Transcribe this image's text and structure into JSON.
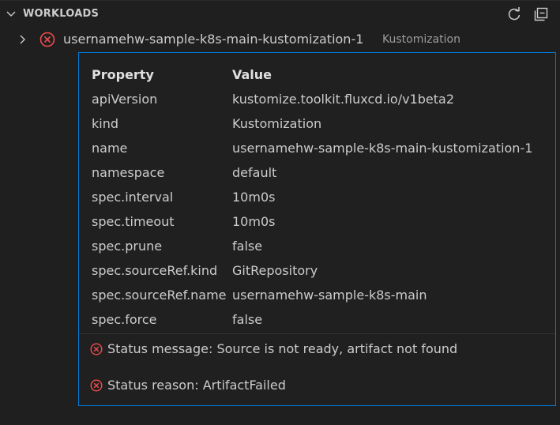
{
  "section": {
    "title": "WORKLOADS"
  },
  "toolbar": {
    "refresh_icon": "refresh-icon",
    "collapse_icon": "collapse-all-icon"
  },
  "colors": {
    "error": "#f14c4c",
    "accent_border": "#0078d4",
    "background": "#1f1f1f"
  },
  "tree": {
    "item": {
      "label": "usernamehw-sample-k8s-main-kustomization-1",
      "description": "Kustomization",
      "status_icon": "error-icon"
    }
  },
  "hover": {
    "headers": {
      "property": "Property",
      "value": "Value"
    },
    "rows": [
      {
        "property": "apiVersion",
        "value": "kustomize.toolkit.fluxcd.io/v1beta2"
      },
      {
        "property": "kind",
        "value": "Kustomization"
      },
      {
        "property": "name",
        "value": "usernamehw-sample-k8s-main-kustomization-1"
      },
      {
        "property": "namespace",
        "value": "default"
      },
      {
        "property": "spec.interval",
        "value": "10m0s"
      },
      {
        "property": "spec.timeout",
        "value": "10m0s"
      },
      {
        "property": "spec.prune",
        "value": "false"
      },
      {
        "property": "spec.sourceRef.kind",
        "value": "GitRepository"
      },
      {
        "property": "spec.sourceRef.name",
        "value": "usernamehw-sample-k8s-main"
      },
      {
        "property": "spec.force",
        "value": "false"
      }
    ],
    "status_message": "Status message: Source is not ready, artifact not found",
    "status_reason": "Status reason: ArtifactFailed"
  }
}
